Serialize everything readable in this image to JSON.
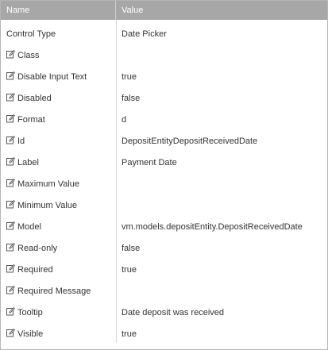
{
  "header": {
    "name": "Name",
    "value": "Value"
  },
  "rows": [
    {
      "name": "Control Type",
      "value": "Date Picker",
      "editable": false
    },
    {
      "name": "Class",
      "value": "",
      "editable": true
    },
    {
      "name": "Disable Input Text",
      "value": "true",
      "editable": true
    },
    {
      "name": "Disabled",
      "value": "false",
      "editable": true
    },
    {
      "name": "Format",
      "value": "d",
      "editable": true
    },
    {
      "name": "Id",
      "value": "DepositEntityDepositReceivedDate",
      "editable": true
    },
    {
      "name": "Label",
      "value": "Payment Date",
      "editable": true
    },
    {
      "name": "Maximum Value",
      "value": "",
      "editable": true
    },
    {
      "name": "Minimum Value",
      "value": "",
      "editable": true
    },
    {
      "name": "Model",
      "value": "vm.models.depositEntity.DepositReceivedDate",
      "editable": true
    },
    {
      "name": "Read-only",
      "value": "false",
      "editable": true
    },
    {
      "name": "Required",
      "value": "true",
      "editable": true
    },
    {
      "name": "Required Message",
      "value": "",
      "editable": true
    },
    {
      "name": "Tooltip",
      "value": "Date deposit was received",
      "editable": true
    },
    {
      "name": "Visible",
      "value": "true",
      "editable": true
    }
  ],
  "icons": {
    "edit": "edit-icon"
  },
  "colors": {
    "header_bg": "#a7a7a7",
    "header_text": "#ffffff",
    "border": "#b5b5b5"
  }
}
